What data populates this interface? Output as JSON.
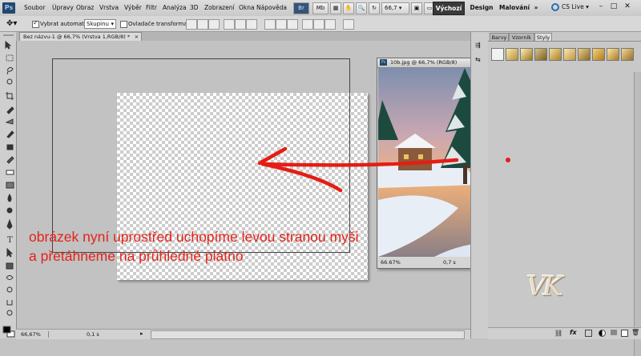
{
  "app": {
    "logo": "Ps"
  },
  "menu": [
    "Soubor",
    "Úpravy",
    "Obraz",
    "Vrstva",
    "Výběr",
    "Filtr",
    "Analýza",
    "3D",
    "Zobrazení",
    "Okna",
    "Nápověda"
  ],
  "menubar_controls": {
    "br": "Br",
    "mb": "Mb",
    "zoom": "66,7",
    "zoom_caret": "▾"
  },
  "workspaces": {
    "active": "Výchozí",
    "others": [
      "Design",
      "Malování"
    ],
    "more": "»",
    "cs_live": "CS Live ▾"
  },
  "window_controls": {
    "minimize": "–",
    "maximize": "□",
    "close": "✕"
  },
  "options": {
    "auto_select_label": "Vybrat automaticky:",
    "auto_select_checked": true,
    "auto_select_value": "Skupinu",
    "transform_label": "Ovladače transformací",
    "transform_checked": false
  },
  "document": {
    "tab_title": "Bez názvu-1 @ 66,7% (Vrstva 1,RGB/8) *",
    "tab_close": "×",
    "zoom_status": "66,67%",
    "timing_status": "0,1 s"
  },
  "floating_window": {
    "title": "10b.jpg @ 66,7% (RGB/8)",
    "zoom_status": "66.67%",
    "timing_status": "0,7 s",
    "controls": [
      "–",
      "□",
      "✕"
    ]
  },
  "panel": {
    "tabs": [
      "Barvy",
      "Vzorník",
      "Styly"
    ],
    "active_tab": "Styly",
    "watermark": "VK"
  },
  "annotation": {
    "line1": "obrázek nyní uprostřed uchopíme levou stranou myši",
    "line2": "a přetáhneme na průhledné plátno",
    "color": "#e2231a"
  },
  "icons": [
    "move-tool-icon",
    "marquee-icon",
    "lasso-icon",
    "quick-select-icon",
    "crop-icon",
    "eyedropper-icon",
    "healing-icon",
    "brush-icon",
    "stamp-icon",
    "history-brush-icon",
    "eraser-icon",
    "gradient-icon",
    "blur-icon",
    "dodge-icon",
    "pen-icon",
    "type-icon",
    "path-select-icon",
    "shape-icon",
    "3d-rotate-icon",
    "3d-orbit-icon",
    "hand-icon",
    "zoom-icon",
    "foreground-color",
    "background-color"
  ]
}
